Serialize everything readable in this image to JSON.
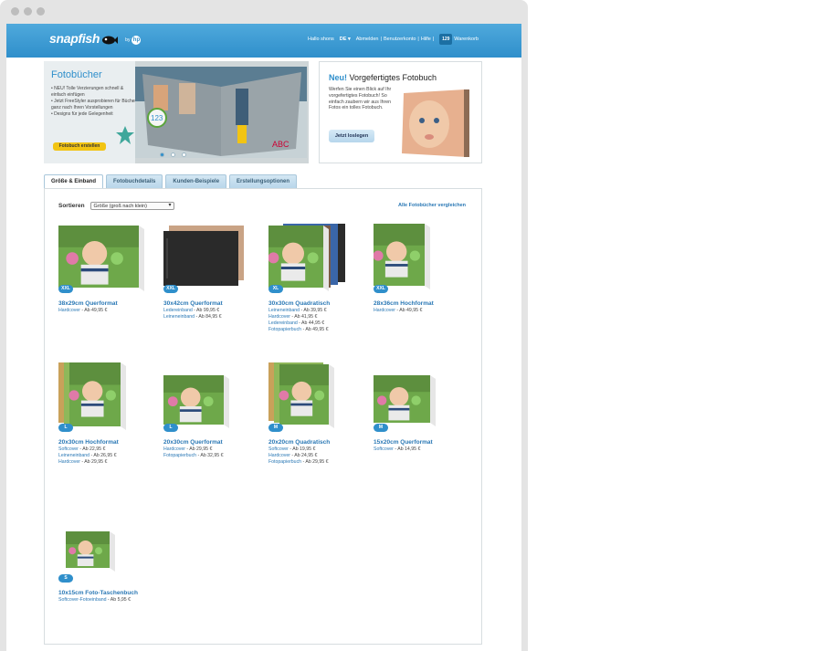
{
  "header": {
    "logo_text": "snapfish",
    "logo_by": "by",
    "hp": "hp",
    "greeting": "Hallo shons",
    "lang": "DE ▾",
    "links": [
      "Abmelden",
      "Benutzerkonto",
      "Hilfe"
    ],
    "cart_count": "129",
    "cart_label": "Warenkorb"
  },
  "hero": {
    "title": "Fotobücher",
    "bullets": [
      "• NEU! Tolle Verzierungen schnell & einfach einfügen",
      "• Jetzt FreeStyler ausprobieren für Bücher ganz nach Ihren Vorstellungen",
      "• Designs für jede Gelegenheit"
    ],
    "button": "Fotobuch erstellen"
  },
  "promo": {
    "title_new": "Neu!",
    "title_rest": " Vorgefertigtes Fotobuch",
    "text": "Werfen Sie einen Blick auf Ihr vorgefertigtes Fotobuch! So einfach zaubern wir aus Ihren Fotos ein tolles Fotobuch.",
    "button": "Jetzt loslegen"
  },
  "tabs": [
    "Größe & Einband",
    "Fotobuchdetails",
    "Kunden-Beispiele",
    "Erstellungsoptionen"
  ],
  "sort": {
    "label": "Sortieren",
    "value": "Größe (groß nach klein)"
  },
  "compare_link": "Alle Fotobücher vergleichen",
  "products": [
    {
      "badge": "XXL",
      "name": "38x29cm Querformat",
      "options": [
        {
          "n": "Hardcover",
          "p": " - Ab 49,95 €"
        }
      ]
    },
    {
      "badge": "XXL",
      "name": "30x42cm Querformat",
      "options": [
        {
          "n": "Ledereinband",
          "p": " - Ab 99,95 €"
        },
        {
          "n": "Leineneinband",
          "p": " - Ab 84,95 €"
        }
      ]
    },
    {
      "badge": "XL",
      "name": "30x30cm Quadratisch",
      "options": [
        {
          "n": "Leineneinband",
          "p": " - Ab 39,95 €"
        },
        {
          "n": "Hardcover",
          "p": " - Ab 41,95 €"
        },
        {
          "n": "Ledereinband",
          "p": " - Ab 44,95 €"
        },
        {
          "n": "Fotopapierbuch",
          "p": " - Ab 49,95 €"
        }
      ]
    },
    {
      "badge": "XXL",
      "name": "28x36cm Hochformat",
      "options": [
        {
          "n": "Hardcover",
          "p": " - Ab 49,95 €"
        }
      ]
    },
    {
      "badge": "L",
      "name": "20x30cm Hochformat",
      "options": [
        {
          "n": "Softcover",
          "p": " - Ab 22,95 €"
        },
        {
          "n": "Leineneinband",
          "p": " - Ab 26,95 €"
        },
        {
          "n": "Hardcover",
          "p": " - Ab 29,95 €"
        }
      ]
    },
    {
      "badge": "L",
      "name": "20x30cm Querformat",
      "options": [
        {
          "n": "Hardcover",
          "p": " - Ab 29,95 €"
        },
        {
          "n": "Fotopapierbuch",
          "p": " - Ab 32,95 €"
        }
      ]
    },
    {
      "badge": "M",
      "name": "20x20cm Quadratisch",
      "options": [
        {
          "n": "Softcover",
          "p": " - Ab 19,95 €"
        },
        {
          "n": "Hardcover",
          "p": " - Ab 24,95 €"
        },
        {
          "n": "Fotopapierbuch",
          "p": " - Ab 29,95 €"
        }
      ]
    },
    {
      "badge": "M",
      "name": "15x20cm Querformat",
      "options": [
        {
          "n": "Softcover",
          "p": " - Ab 14,95 €"
        }
      ]
    },
    {
      "badge": "S",
      "name": "10x15cm Foto-Taschenbuch",
      "options": [
        {
          "n": "Softcover-Fotoeinband",
          "p": " - Ab 5,95 €"
        }
      ]
    }
  ]
}
